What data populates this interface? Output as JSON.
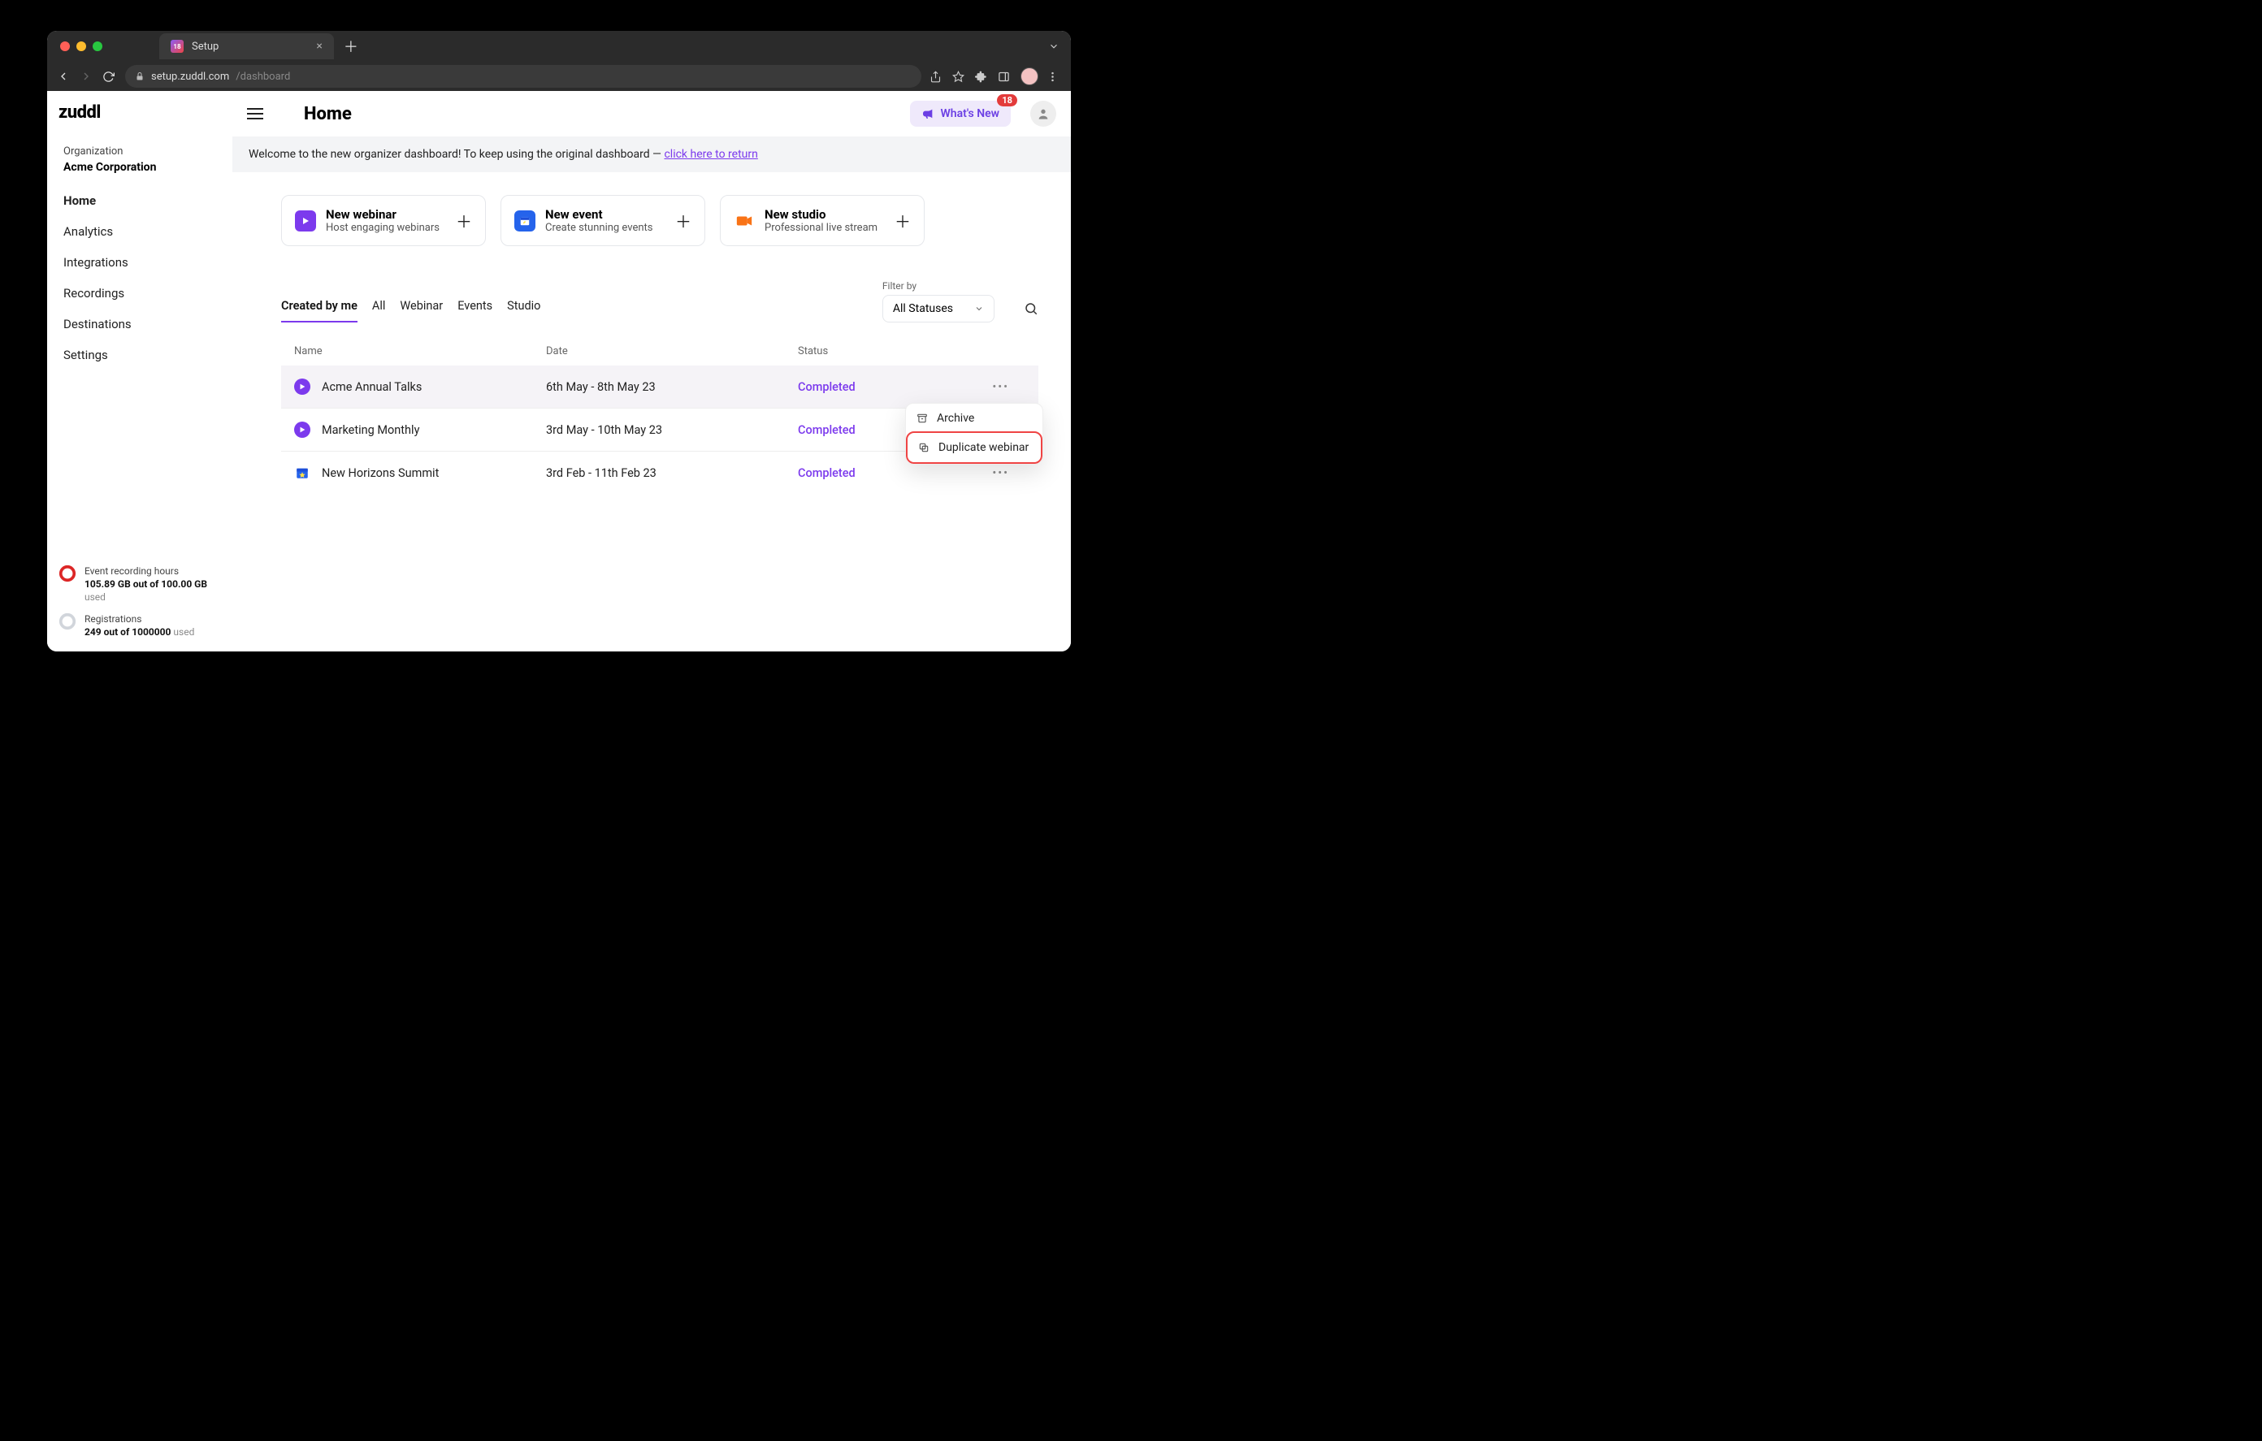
{
  "browser": {
    "tab_title": "Setup",
    "url_host": "setup.zuddl.com",
    "url_path": "/dashboard"
  },
  "brand": "zuddl",
  "sidebar": {
    "org_label": "Organization",
    "org_name": "Acme Corporation",
    "items": [
      "Home",
      "Analytics",
      "Integrations",
      "Recordings",
      "Destinations",
      "Settings"
    ]
  },
  "usage": {
    "recording": {
      "title": "Event recording hours",
      "line": "105.89 GB out of 100.00 GB",
      "suffix": "used"
    },
    "registrations": {
      "title": "Registrations",
      "line": "249 out of 1000000",
      "suffix": "used"
    }
  },
  "header": {
    "page_title": "Home",
    "whats_new": "What's New",
    "whats_new_badge": "18"
  },
  "banner": {
    "text": "Welcome to the new organizer dashboard! To keep using the original dashboard  — ",
    "link": "click here to return"
  },
  "cards": [
    {
      "title": "New webinar",
      "sub": "Host engaging webinars"
    },
    {
      "title": "New event",
      "sub": "Create stunning events"
    },
    {
      "title": "New studio",
      "sub": "Professional live stream"
    }
  ],
  "tabs": [
    "Created by me",
    "All",
    "Webinar",
    "Events",
    "Studio"
  ],
  "filter": {
    "label": "Filter by",
    "value": "All Statuses"
  },
  "table": {
    "headers": [
      "Name",
      "Date",
      "Status"
    ],
    "rows": [
      {
        "icon": "play",
        "name": "Acme Annual Talks",
        "date": "6th May - 8th May 23",
        "status": "Completed"
      },
      {
        "icon": "play",
        "name": "Marketing Monthly",
        "date": "3rd May - 10th May 23",
        "status": "Completed"
      },
      {
        "icon": "cal",
        "name": "New Horizons Summit",
        "date": "3rd Feb - 11th Feb 23",
        "status": "Completed"
      }
    ]
  },
  "context_menu": {
    "archive": "Archive",
    "duplicate": "Duplicate webinar"
  }
}
